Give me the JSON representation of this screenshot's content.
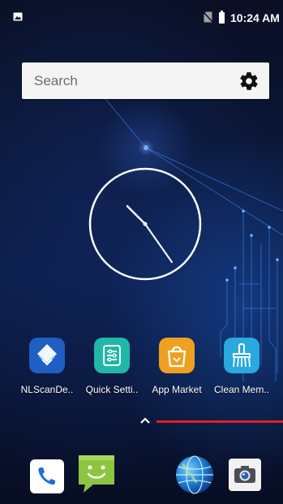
{
  "status_bar": {
    "time": "10:24 AM",
    "icons": [
      "gallery-notification-icon",
      "no-sim-icon",
      "battery-icon"
    ]
  },
  "search": {
    "placeholder": "Search",
    "settings_icon": "gear-icon"
  },
  "clock_widget": {
    "type": "analog-clock",
    "time_shown": "10:24"
  },
  "apps": [
    {
      "label": "NLScanDe..",
      "icon": "nlscan-demo-icon",
      "color": "#1f5fc4"
    },
    {
      "label": "Quick Setti..",
      "icon": "quick-settings-icon",
      "color": "#1fb8a6"
    },
    {
      "label": "App Market",
      "icon": "app-market-icon",
      "color": "#f0a020"
    },
    {
      "label": "Clean Mem..",
      "icon": "clean-memory-icon",
      "color": "#2aa8e0"
    }
  ],
  "app_drawer_handle": "chevron-up-icon",
  "dock": [
    {
      "name": "phone",
      "icon": "phone-icon"
    },
    {
      "name": "messaging",
      "icon": "sms-icon"
    },
    {
      "name": "browser",
      "icon": "browser-globe-icon"
    },
    {
      "name": "camera",
      "icon": "camera-icon"
    }
  ],
  "colors": {
    "annotation_line": "#e02020",
    "search_background": "#f4f4f4"
  }
}
